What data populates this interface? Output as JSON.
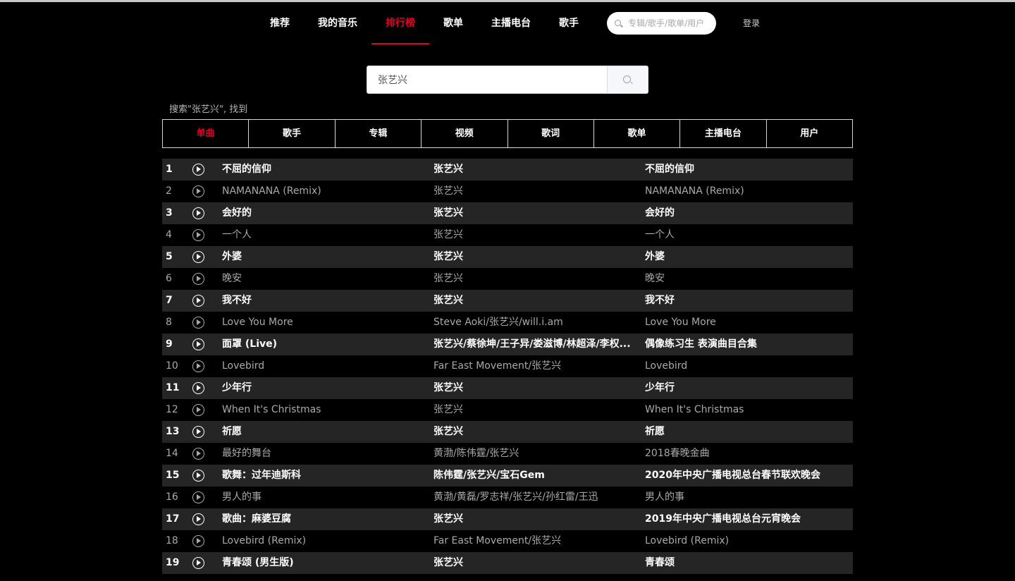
{
  "nav": {
    "items": [
      {
        "label": "推荐"
      },
      {
        "label": "我的音乐"
      },
      {
        "label": "排行榜"
      },
      {
        "label": "歌单"
      },
      {
        "label": "主播电台"
      },
      {
        "label": "歌手"
      }
    ],
    "active_index": 2,
    "search_placeholder": "专辑/歌手/歌单/用户",
    "login_label": "登录"
  },
  "search": {
    "query": "张艺兴",
    "result_text": "搜索\"张艺兴\", 找到"
  },
  "tabs": [
    {
      "label": "单曲",
      "active": true
    },
    {
      "label": "歌手",
      "active": false
    },
    {
      "label": "专辑",
      "active": false
    },
    {
      "label": "视频",
      "active": false
    },
    {
      "label": "歌词",
      "active": false
    },
    {
      "label": "歌单",
      "active": false
    },
    {
      "label": "主播电台",
      "active": false
    },
    {
      "label": "用户",
      "active": false
    }
  ],
  "songs": [
    {
      "index": "1",
      "name": "不屈的信仰",
      "artist": "张艺兴",
      "album": "不屈的信仰"
    },
    {
      "index": "2",
      "name": "NAMANANA (Remix)",
      "artist": "张艺兴",
      "album": "NAMANANA (Remix)"
    },
    {
      "index": "3",
      "name": "会好的",
      "artist": "张艺兴",
      "album": "会好的"
    },
    {
      "index": "4",
      "name": "一个人",
      "artist": "张艺兴",
      "album": "一个人"
    },
    {
      "index": "5",
      "name": "外婆",
      "artist": "张艺兴",
      "album": "外婆"
    },
    {
      "index": "6",
      "name": "晚安",
      "artist": "张艺兴",
      "album": "晚安"
    },
    {
      "index": "7",
      "name": "我不好",
      "artist": "张艺兴",
      "album": "我不好"
    },
    {
      "index": "8",
      "name": "Love You More",
      "artist": "Steve Aoki/张艺兴/will.i.am",
      "album": "Love You More"
    },
    {
      "index": "9",
      "name": "面罩 (Live)",
      "artist": "张艺兴/蔡徐坤/王子异/娄滋博/林超泽/李权...",
      "album": "偶像练习生 表演曲目合集"
    },
    {
      "index": "10",
      "name": "Lovebird",
      "artist": "Far East Movement/张艺兴",
      "album": "Lovebird"
    },
    {
      "index": "11",
      "name": "少年行",
      "artist": "张艺兴",
      "album": "少年行"
    },
    {
      "index": "12",
      "name": "When It's Christmas",
      "artist": "张艺兴",
      "album": "When It's Christmas"
    },
    {
      "index": "13",
      "name": "祈愿",
      "artist": "张艺兴",
      "album": "祈愿"
    },
    {
      "index": "14",
      "name": "最好的舞台",
      "artist": "黄渤/陈伟霆/张艺兴",
      "album": "2018春晚金曲"
    },
    {
      "index": "15",
      "name": "歌舞：过年迪斯科",
      "artist": "陈伟霆/张艺兴/宝石Gem",
      "album": "2020年中央广播电视总台春节联欢晚会"
    },
    {
      "index": "16",
      "name": "男人的事",
      "artist": "黄渤/黄磊/罗志祥/张艺兴/孙红雷/王迅",
      "album": "男人的事"
    },
    {
      "index": "17",
      "name": "歌曲：麻婆豆腐",
      "artist": "张艺兴",
      "album": "2019年中央广播电视总台元宵晚会"
    },
    {
      "index": "18",
      "name": "Lovebird (Remix)",
      "artist": "Far East Movement/张艺兴",
      "album": "Lovebird (Remix)"
    },
    {
      "index": "19",
      "name": "青春颂 (男生版)",
      "artist": "张艺兴",
      "album": "青春颂"
    }
  ],
  "colors": {
    "accent": "#e60026",
    "background": "#000000",
    "row_alt": "#252525",
    "muted_text": "#a9a9a9"
  },
  "icons": {
    "nav_search": "search-icon",
    "main_search": "search-icon",
    "row_play": "play-circle-icon"
  }
}
